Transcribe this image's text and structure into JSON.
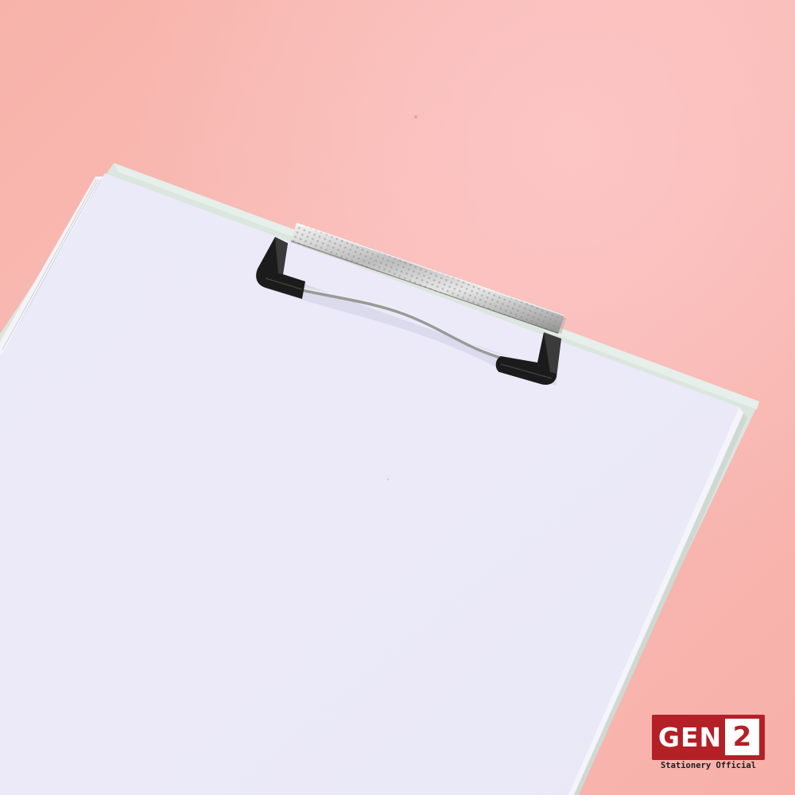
{
  "scene": {
    "description_colors": {
      "background": "#f8b7b0",
      "paper": "#eeeef9",
      "board_edge": "#d9e4de",
      "clip_metal": "#c9c9c9",
      "clip_rubber": "#1d1d1d"
    }
  },
  "brand": {
    "name": "GEN",
    "number": "2",
    "tagline": "Stationery Official",
    "accent_color": "#b32025"
  }
}
